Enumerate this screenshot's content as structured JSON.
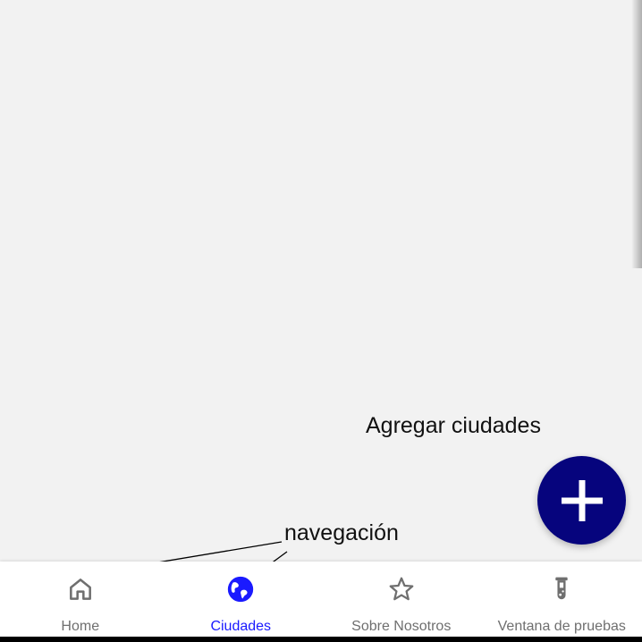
{
  "annotations": {
    "fab_label": "Agregar ciudades",
    "nav_label": "navegación"
  },
  "fab": {
    "icon": "plus-icon",
    "color": "#06047d"
  },
  "bottom_nav": {
    "active_color": "#1a1aff",
    "inactive_color": "#6f6f6f",
    "items": [
      {
        "label": "Home",
        "icon": "home-icon",
        "active": false
      },
      {
        "label": "Ciudades",
        "icon": "globe-icon",
        "active": true
      },
      {
        "label": "Sobre Nosotros",
        "icon": "star-icon",
        "active": false
      },
      {
        "label": "Ventana de pruebas",
        "icon": "test-tube-icon",
        "active": false
      }
    ]
  }
}
